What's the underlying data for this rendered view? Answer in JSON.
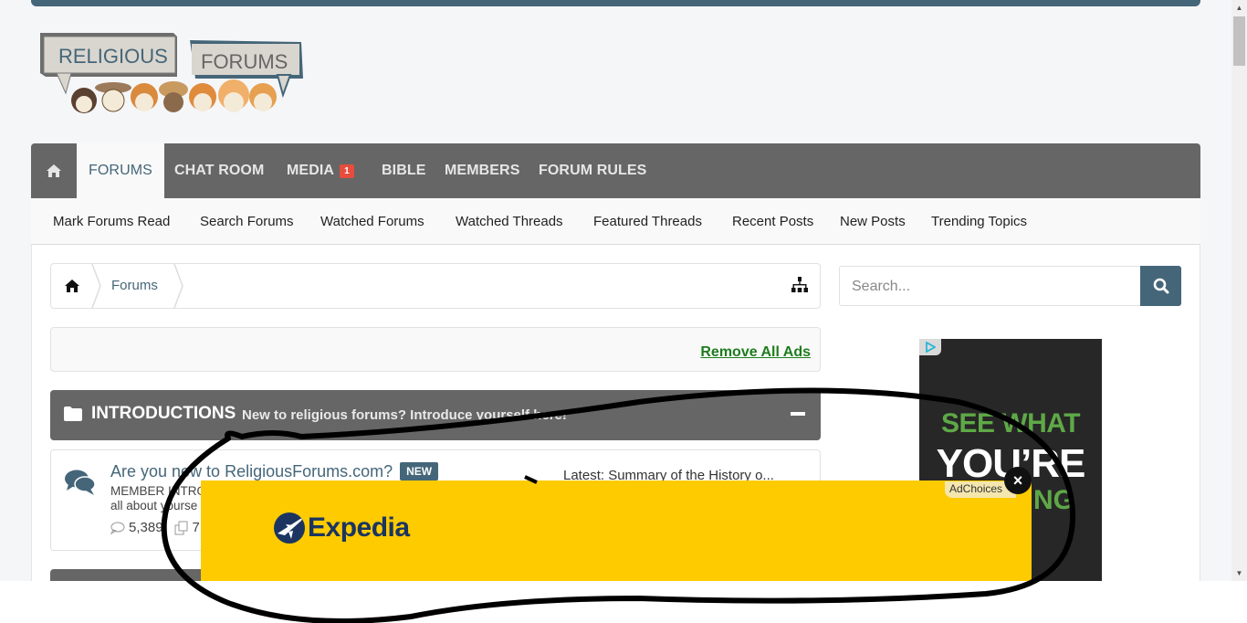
{
  "site": {
    "logo_line1": "RELIGIOUS",
    "logo_line2": "FORUMS",
    "brand_color": "#456679"
  },
  "nav": {
    "home_icon": "home-icon",
    "tabs": [
      {
        "label": "FORUMS",
        "active": true
      },
      {
        "label": "CHAT ROOM"
      },
      {
        "label": "MEDIA",
        "badge": "1"
      },
      {
        "label": "BIBLE"
      },
      {
        "label": "MEMBERS"
      },
      {
        "label": "FORUM RULES"
      }
    ]
  },
  "subnav": {
    "items": [
      "Mark Forums Read",
      "Search Forums",
      "Watched Forums",
      "Watched Threads",
      "Featured Threads",
      "Recent Posts",
      "New Posts",
      "Trending Topics"
    ]
  },
  "breadcrumb": {
    "home_icon": "home-icon",
    "items": [
      "Forums"
    ],
    "sitemap_icon": "sitemap-icon"
  },
  "ads_bar": {
    "remove_label": "Remove All Ads",
    "remove_color": "#1e7d1e"
  },
  "search": {
    "placeholder": "Search...",
    "button_icon": "search-icon"
  },
  "category": {
    "title": "INTRODUCTIONS",
    "description": "New to religious forums? Introduce yourself here!",
    "collapse_icon": "minus-icon"
  },
  "forum": {
    "title": "Are you new to ReligiousForums.com?",
    "badge": "NEW",
    "desc_line1": "MEMBER INTRO",
    "desc_line2": "all about yourse",
    "threads": "5,389",
    "messages": "7",
    "latest": "Latest: Summary of the History o..."
  },
  "side_ad": {
    "line1": "SEE WHAT",
    "line2": "YOU’RE",
    "line3": "NG",
    "adchoices": "AdChoices"
  },
  "bottom_ad": {
    "brand": "Expedia",
    "bg_color": "#fecb00",
    "close_label": "×"
  }
}
